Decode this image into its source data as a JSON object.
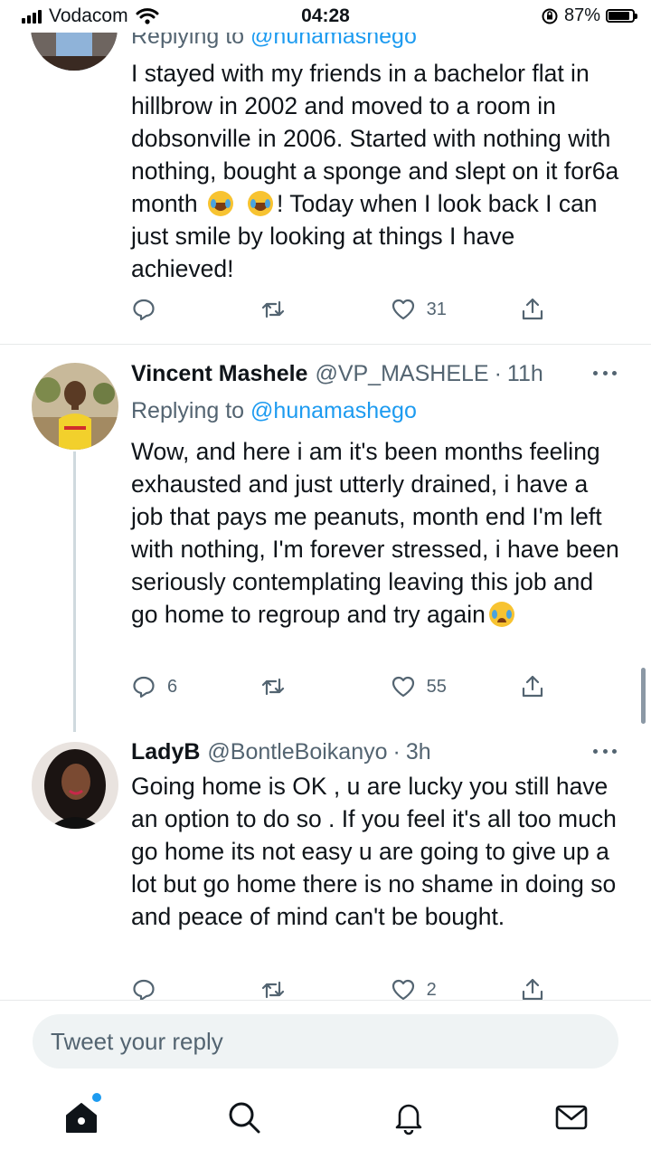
{
  "status_bar": {
    "carrier": "Vodacom",
    "time": "04:28",
    "battery_percent": "87%",
    "battery_level": 0.87
  },
  "tweets": [
    {
      "reply_prefix": "Replying to ",
      "reply_handle": "@hunamashego",
      "text_parts": [
        "I stayed with my friends in a bachelor flat in hillbrow in 2002 and moved to a room in dobsonville in 2006. Started with nothing with nothing, bought a sponge and slept on it for6a month ",
        "! Today when I look back I can just smile by looking at things I have achieved!"
      ],
      "emoji": [
        "face-with-tears-of-joy",
        "face-with-tears-of-joy"
      ],
      "reply_count": "",
      "like_count": "31"
    },
    {
      "name": "Vincent Mashele",
      "handle": "@VP_MASHELE",
      "separator": "·",
      "time": "11h",
      "reply_prefix": "Replying to ",
      "reply_handle": "@hunamashego",
      "text": "Wow, and here i am it's been months feeling exhausted and just utterly drained, i have a job that pays me peanuts, month end I'm left with nothing, I'm forever stressed, i have been seriously contemplating leaving this job and go home to regroup and try again",
      "emoji": [
        "crying-face"
      ],
      "reply_count": "6",
      "like_count": "55"
    },
    {
      "name": "LadyB",
      "handle": "@BontleBoikanyo",
      "separator": "·",
      "time": "3h",
      "text": "Going home is OK , u are lucky you still have an option to do so . If you feel it's all too much go home its not easy u are going to give up a lot but go home there is no shame in doing so and peace of mind can't be bought.",
      "reply_count": "",
      "like_count": "2"
    }
  ],
  "composer": {
    "placeholder": "Tweet your reply"
  },
  "tab_bar": [
    "home-icon",
    "search-icon",
    "notifications-icon",
    "messages-icon"
  ],
  "colors": {
    "accent": "#1d9bf0",
    "text": "#0f1419",
    "muted": "#536471",
    "divider": "#e7e9ea"
  }
}
